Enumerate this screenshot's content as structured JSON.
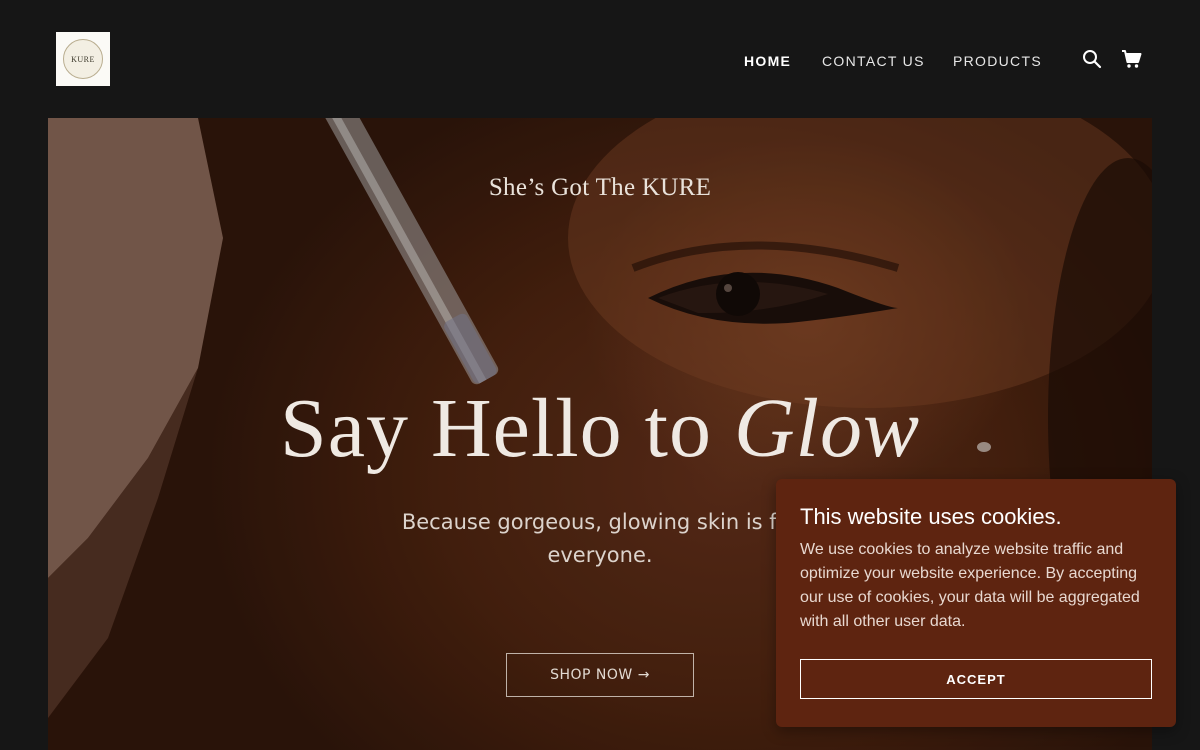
{
  "header": {
    "logo_text": "KURE",
    "nav": [
      {
        "label": "HOME",
        "active": true
      },
      {
        "label": "CONTACT US",
        "active": false
      },
      {
        "label": "PRODUCTS",
        "active": false
      }
    ],
    "icons": [
      "search-icon",
      "cart-icon"
    ]
  },
  "hero": {
    "tagline": "She’s Got The KURE",
    "title_part1": "Say Hello to ",
    "title_part2": "Glow",
    "subtitle": "Because gorgeous, glowing skin is for everyone.",
    "cta_label": "SHOP NOW →"
  },
  "cookie_banner": {
    "title": "This website uses cookies.",
    "body": "We use cookies to analyze website traffic and optimize your website experience. By accepting our use of cookies, your data will be aggregated with all other user data.",
    "accept_label": "ACCEPT",
    "background_color": "#5e2410"
  }
}
